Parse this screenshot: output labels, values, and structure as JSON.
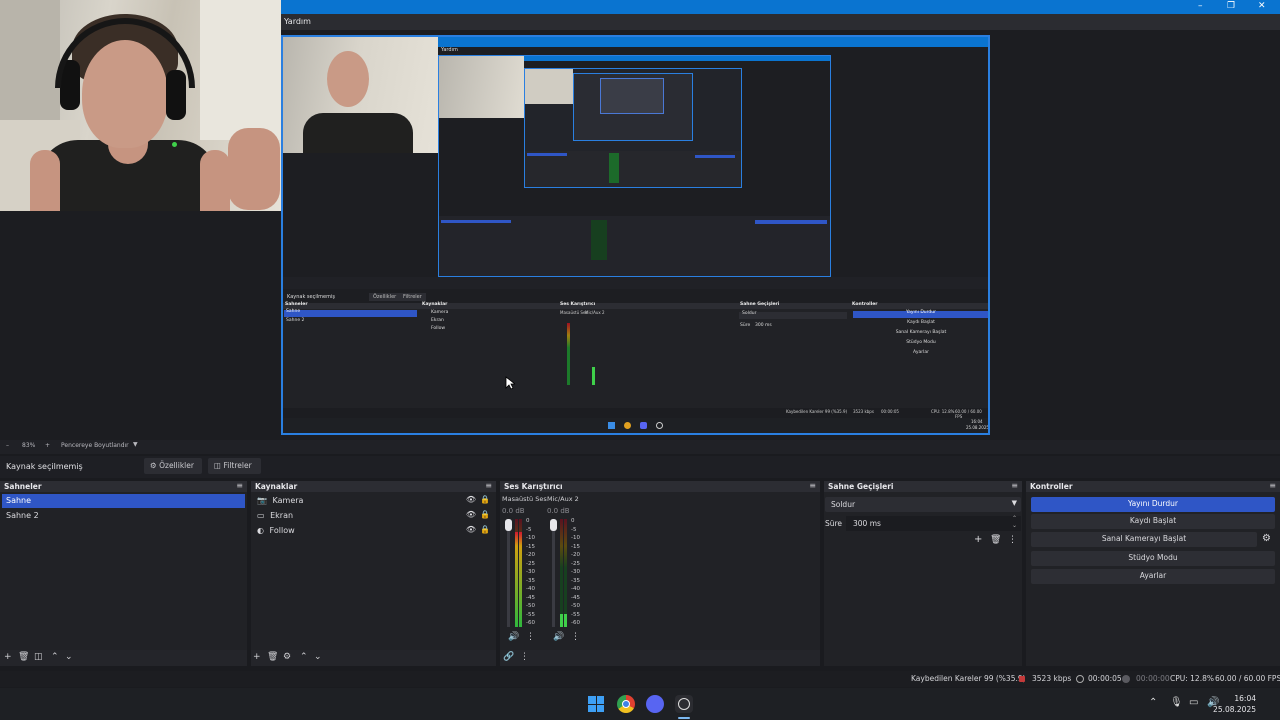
{
  "menu": {
    "help": "Yardım"
  },
  "preview_bar": {
    "zoom": "83%",
    "window_mode": "Pencereye Boyutlandır"
  },
  "source_toolbar": {
    "label": "Kaynak seçilmemiş",
    "properties": "Özellikler",
    "filters": "Filtreler"
  },
  "nested": {
    "menu_help": "Yardım",
    "source_label": "Kaynak seçilmemiş",
    "properties": "Özellikler",
    "filters": "Filtreler",
    "scenes_title": "Sahneler",
    "sources_title": "Kaynaklar",
    "mixer_title": "Ses Karıştırıcı",
    "transitions_title": "Sahne Geçişleri",
    "controls_title": "Kontroller",
    "scene1": "Sahne",
    "scene2": "Sahne 2",
    "src1": "Kamera",
    "src2": "Ekran",
    "src3": "Follow",
    "mix1": "Masaüstü Ses",
    "mix2": "Mic/Aux 2",
    "transition": "Soldur",
    "dur_label": "Süre",
    "dur_value": "300 ms",
    "btn1": "Yayını Durdur",
    "btn2": "Kaydı Başlat",
    "btn3": "Sanal Kamerayı Başlat",
    "btn4": "Stüdyo Modu",
    "btn5": "Ayarlar",
    "dropped": "Kaybedilen Kareler 99 (%35.9)",
    "kbps": "3523 kbps",
    "time": "00:00:05",
    "cpu": "CPU: 12.8%",
    "fps": "60.00 / 60.00 FPS",
    "clock": "16:04",
    "date": "25.08.2025"
  },
  "scenes": {
    "title": "Sahneler",
    "items": [
      "Sahne",
      "Sahne 2"
    ]
  },
  "sources": {
    "title": "Kaynaklar",
    "items": [
      "Kamera",
      "Ekran",
      "Follow"
    ]
  },
  "mixer": {
    "title": "Ses Karıştırıcı",
    "channels": [
      {
        "name": "Masaüstü Ses",
        "db": "0.0 dB",
        "level": 0.88
      },
      {
        "name": "Mic/Aux 2",
        "db": "0.0 dB",
        "level": 0.12
      }
    ],
    "scale": [
      "0",
      "-5",
      "-10",
      "-15",
      "-20",
      "-25",
      "-30",
      "-35",
      "-40",
      "-45",
      "-50",
      "-55",
      "-60"
    ]
  },
  "transitions": {
    "title": "Sahne Geçişleri",
    "selected": "Soldur",
    "duration_label": "Süre",
    "duration_value": "300 ms"
  },
  "controls": {
    "title": "Kontroller",
    "stop_stream": "Yayını Durdur",
    "start_record": "Kaydı Başlat",
    "virtual_cam": "Sanal Kamerayı Başlat",
    "studio_mode": "Stüdyo Modu",
    "settings": "Ayarlar"
  },
  "status": {
    "dropped_frames": "Kaybedilen Kareler 99 (%35.9)",
    "bitrate": "3523 kbps",
    "stream_time": "00:00:05",
    "record_time": "00:00:00",
    "cpu": "CPU: 12.8%",
    "fps": "60.00 / 60.00 FPS"
  },
  "taskbar": {
    "time": "16:04",
    "date": "25.08.2025"
  },
  "colors": {
    "accent": "#2f56c6",
    "titlebar": "#0a74d0",
    "panel": "#212226",
    "header": "#2c2d33"
  }
}
